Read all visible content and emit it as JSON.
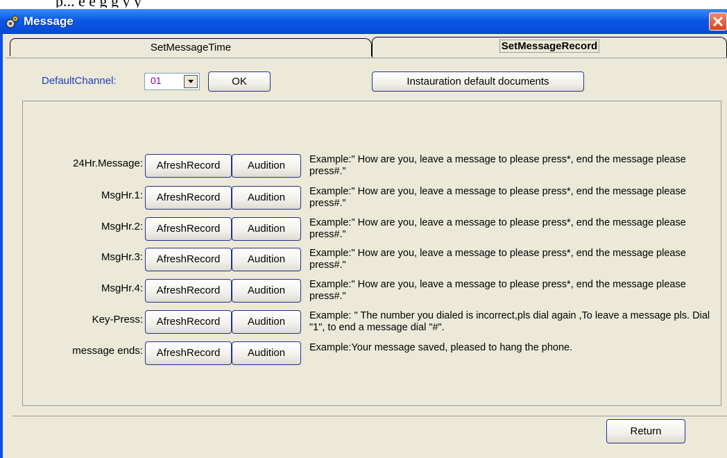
{
  "background_text": "p... e   e   g  g                  y        y",
  "window": {
    "title": "Message"
  },
  "tabs": [
    {
      "label": "SetMessageTime",
      "active": false
    },
    {
      "label": "SetMessageRecord",
      "active": true
    }
  ],
  "toolbar": {
    "default_channel_label": "DefaultChannel:",
    "channel_value": "01",
    "ok_label": "OK",
    "restore_label": "Instauration default documents"
  },
  "rows": [
    {
      "label": "24Hr.Message:",
      "record_label": "AfreshRecord",
      "audition_label": "Audition",
      "example": "Example:\" How are you,  leave a message to please press*, end the message please press#.\""
    },
    {
      "label": "MsgHr.1:",
      "record_label": "AfreshRecord",
      "audition_label": "Audition",
      "example": "Example:\" How are you,  leave a message to please press*, end the message please press#.\""
    },
    {
      "label": "MsgHr.2:",
      "record_label": "AfreshRecord",
      "audition_label": "Audition",
      "example": "Example:\" How are you,  leave a message to please press*, end the message please press#.\""
    },
    {
      "label": "MsgHr.3:",
      "record_label": "AfreshRecord",
      "audition_label": "Audition",
      "example": "Example:\" How are you,  leave a message to please press*, end the message please press#.\""
    },
    {
      "label": "MsgHr.4:",
      "record_label": "AfreshRecord",
      "audition_label": "Audition",
      "example": "Example:\" How are you,  leave a message to please press*, end the message please press#.\""
    },
    {
      "label": "Key-Press:",
      "record_label": "AfreshRecord",
      "audition_label": "Audition",
      "example": "Example: \" The number you dialed is incorrect,pls dial again ,To leave a message pls. Dial \"1\", to end a message dial \"#\"."
    },
    {
      "label": "message ends:",
      "record_label": "AfreshRecord",
      "audition_label": "Audition",
      "example": "Example:Your message saved, pleased to hang the phone."
    }
  ],
  "footer": {
    "return_label": "Return"
  },
  "colors": {
    "titlebar": "#0a58e6",
    "client": "#ece9d8",
    "label_blue": "#1a3cc8",
    "channel_value": "#8000c0"
  },
  "icons": {
    "window_icon": "gears-icon",
    "close": "close-icon",
    "dropdown": "chevron-down-icon"
  }
}
